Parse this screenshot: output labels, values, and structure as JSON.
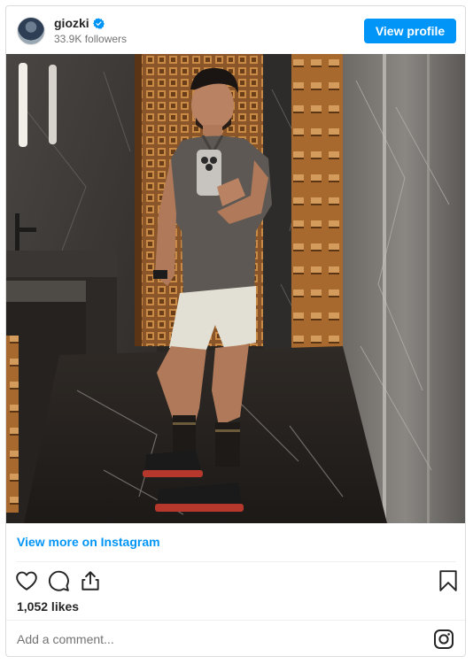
{
  "post": {
    "username": "giozki",
    "verified": true,
    "followers": "33.9K followers",
    "view_profile_label": "View profile",
    "view_more_label": "View more on Instagram",
    "likes": "1,052 likes",
    "comment_placeholder": "Add a comment..."
  },
  "icons": {
    "verified": "verified-badge-icon",
    "like": "heart-icon",
    "comment": "comment-icon",
    "share": "share-icon",
    "save": "bookmark-icon",
    "instagram": "instagram-logo-icon"
  },
  "colors": {
    "accent": "#0095f6",
    "text": "#262626",
    "muted": "#737373",
    "border": "#dbdbdb"
  }
}
